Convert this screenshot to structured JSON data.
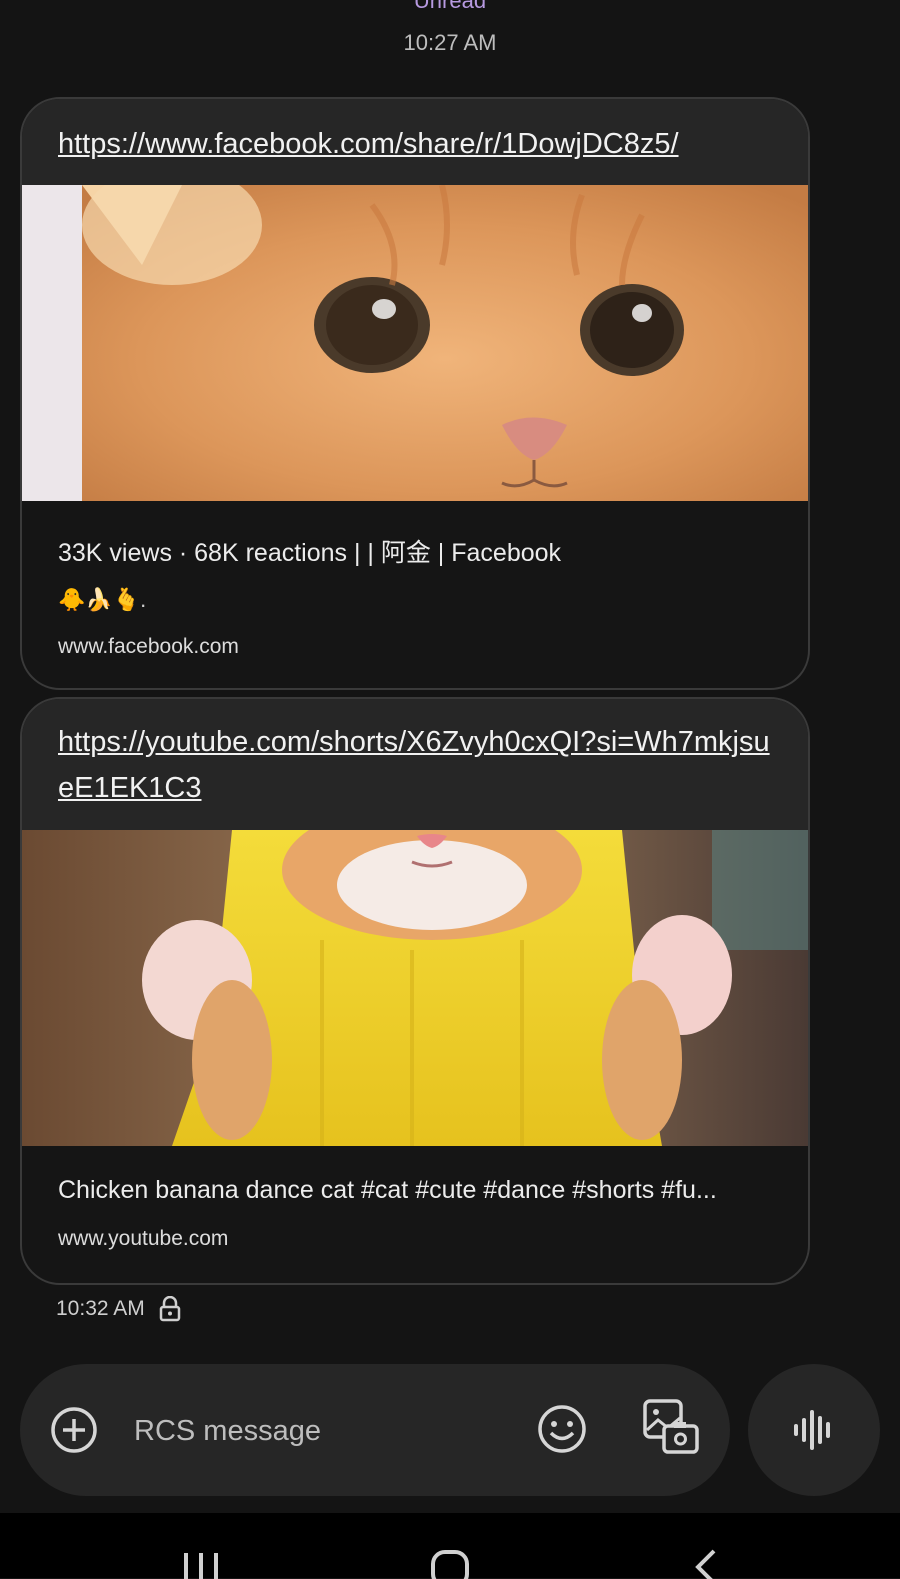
{
  "header": {
    "unread_label": "Unread",
    "timestamp": "10:27 AM"
  },
  "messages": [
    {
      "url": "https://www.facebook.com/share/r/1DowjDC8z5/",
      "title": "33K views · 68K reactions | | 阿金 | Facebook",
      "description": "🐥🍌🫰.",
      "domain": "www.facebook.com",
      "thumbnail": "orange kitten close-up face"
    },
    {
      "url": "https://youtube.com/shorts/X6Zvyh0cxQI?si=Wh7mkjsueE1EK1C3",
      "title": "Chicken banana dance cat #cat #cute #dance #shorts #fu...",
      "domain": "www.youtube.com",
      "thumbnail": "kitten in banana costume dancing"
    }
  ],
  "footer": {
    "timestamp": "10:32 AM",
    "lock_icon": "lock-icon"
  },
  "composer": {
    "placeholder": "RCS message",
    "add_icon": "plus-circle-icon",
    "emoji_icon": "emoji-icon",
    "gallery_icon": "gallery-camera-icon",
    "voice_icon": "voice-waveform-icon"
  },
  "navigation": {
    "recents_icon": "recents-icon",
    "home_icon": "home-icon",
    "back_icon": "back-icon"
  },
  "colors": {
    "background": "#141414",
    "bubble": "#262626",
    "accent": "#b79ae0"
  }
}
